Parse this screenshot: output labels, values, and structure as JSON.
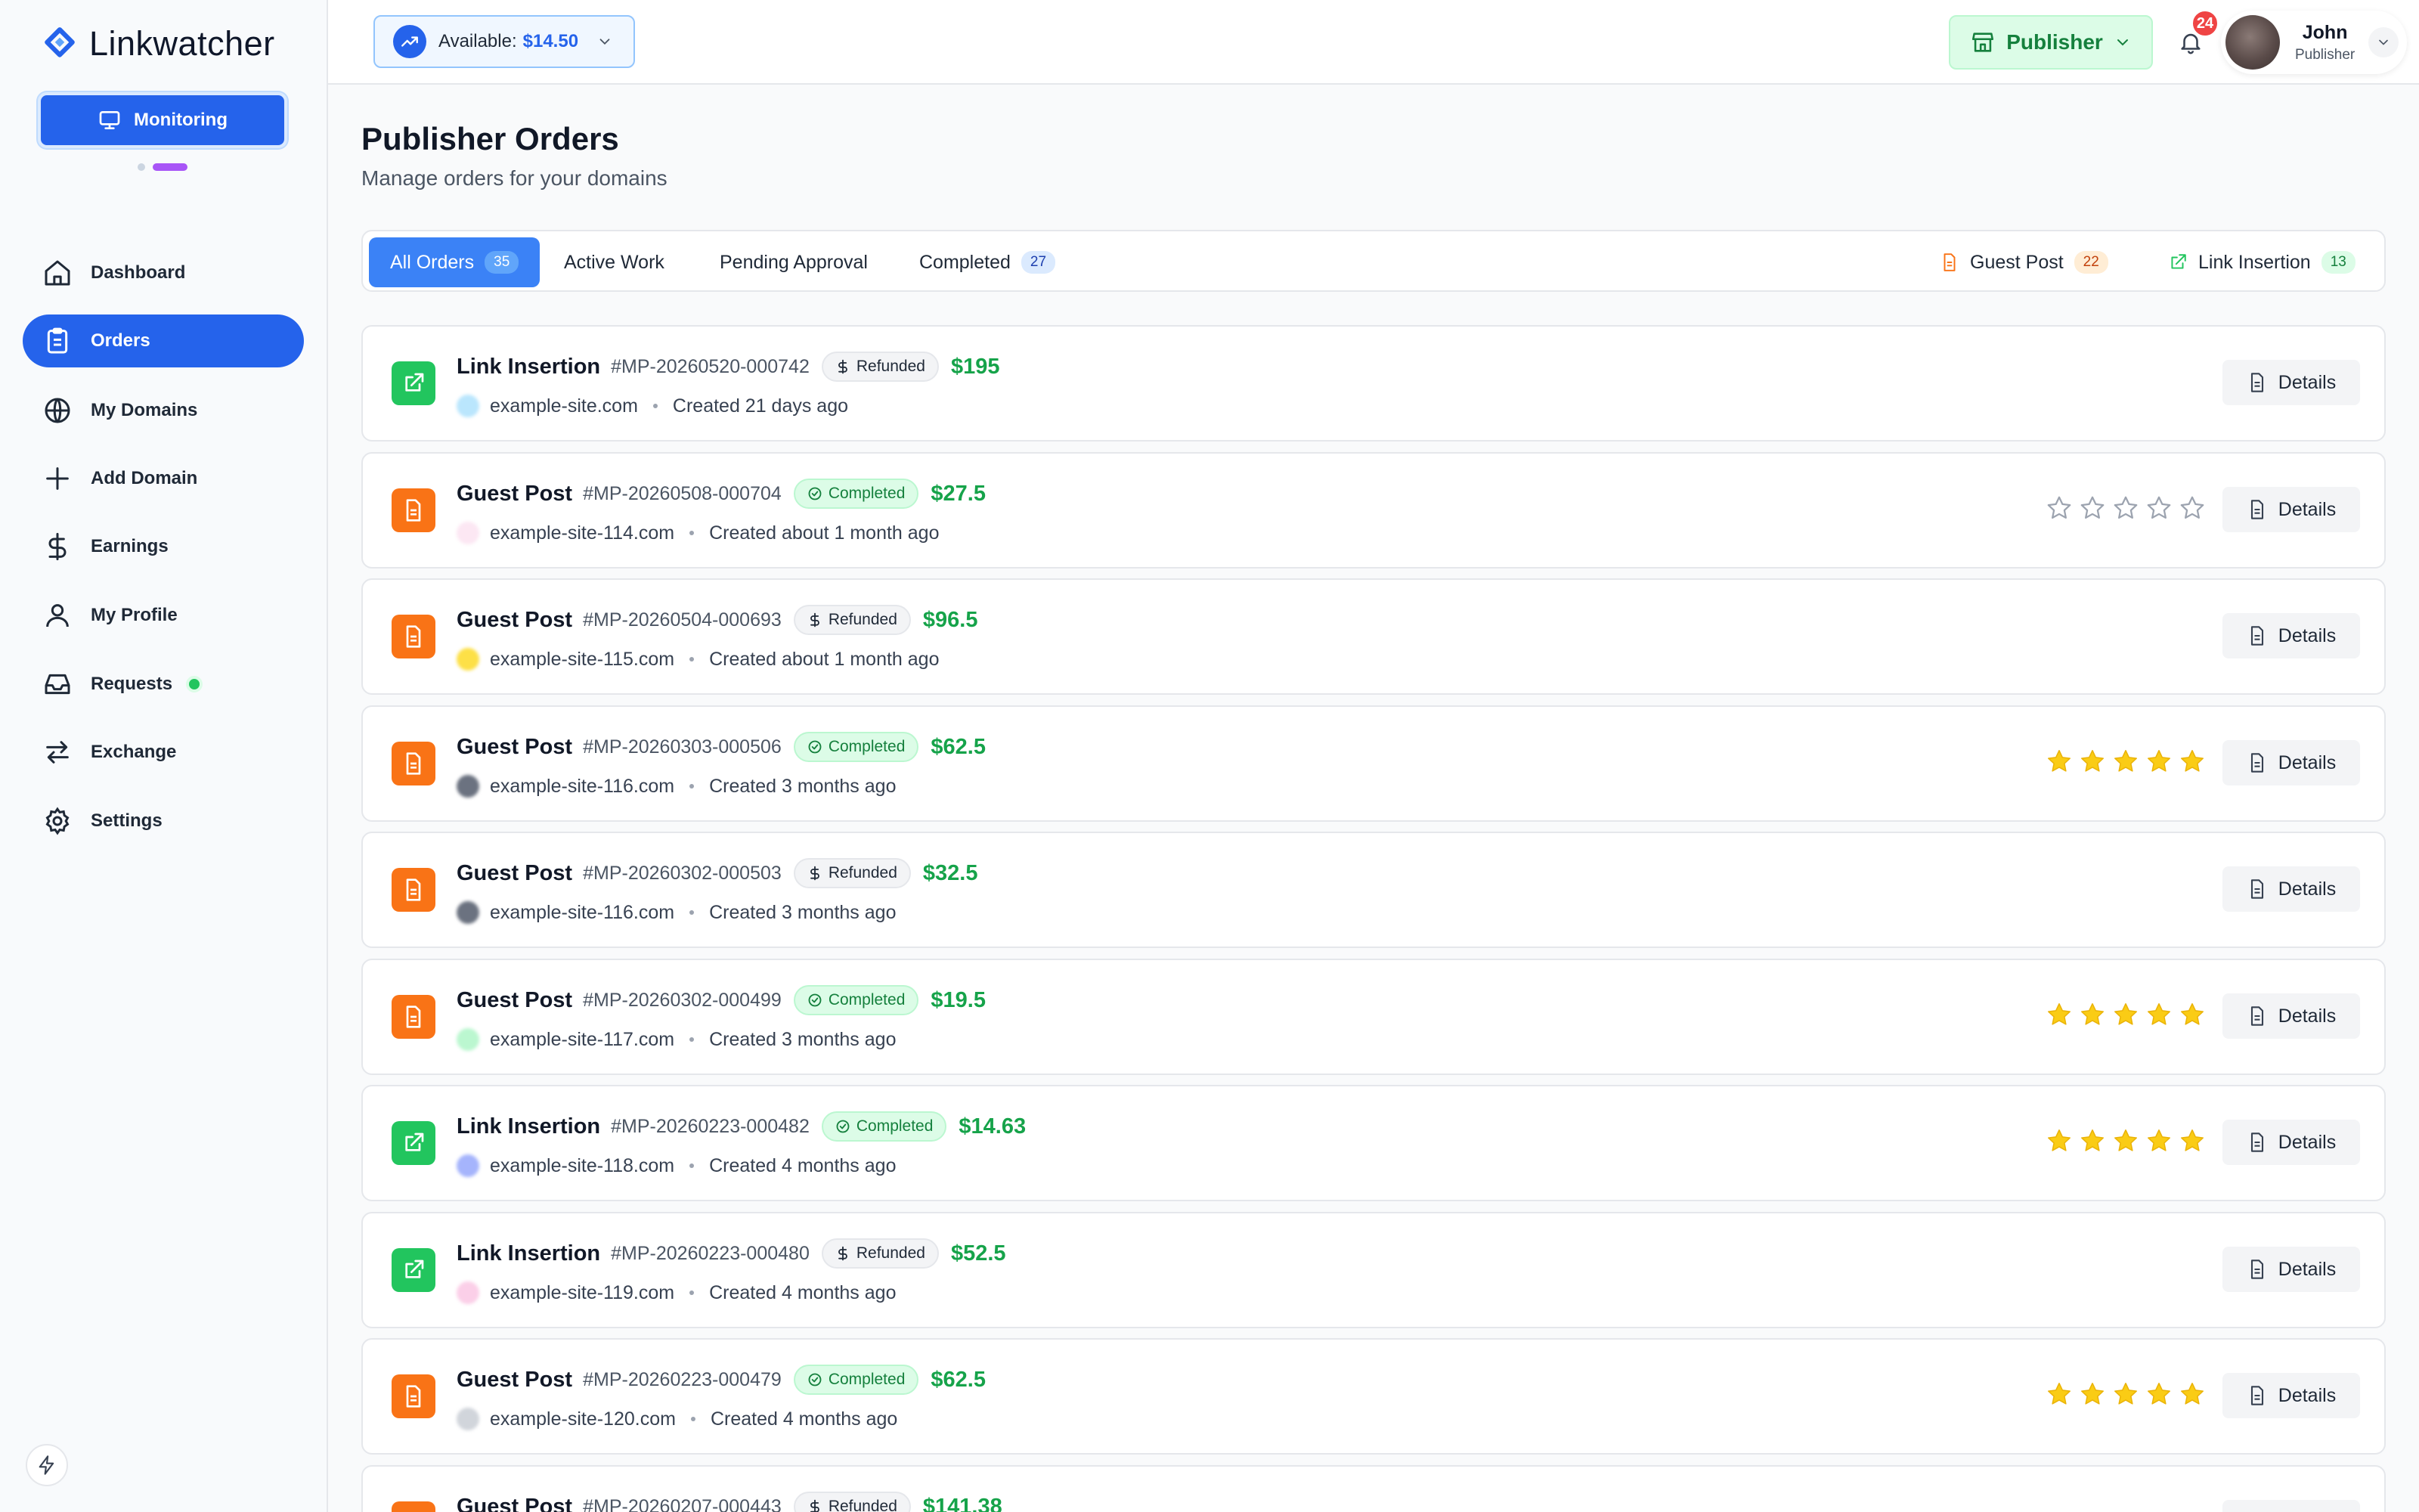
{
  "brand": {
    "name": "Linkwatcher"
  },
  "monitor_button": {
    "label": "Monitoring"
  },
  "sidebar": {
    "items": [
      {
        "label": "Dashboard",
        "icon": "home-icon"
      },
      {
        "label": "Orders",
        "icon": "clipboard-icon",
        "active": true
      },
      {
        "label": "My Domains",
        "icon": "globe-icon"
      },
      {
        "label": "Add Domain",
        "icon": "plus-icon"
      },
      {
        "label": "Earnings",
        "icon": "dollar-icon"
      },
      {
        "label": "My Profile",
        "icon": "user-icon"
      },
      {
        "label": "Requests",
        "icon": "inbox-icon",
        "status_dot": "#22c55e"
      },
      {
        "label": "Exchange",
        "icon": "exchange-icon"
      },
      {
        "label": "Settings",
        "icon": "gear-icon"
      }
    ]
  },
  "header": {
    "balance_label": "Available:",
    "balance_amount": "$14.50",
    "role_button": "Publisher",
    "notifications_count": "24",
    "user_name": "John",
    "user_role": "Publisher"
  },
  "page": {
    "title": "Publisher Orders",
    "subtitle": "Manage orders for your domains"
  },
  "tabs": [
    {
      "label": "All Orders",
      "count": "35",
      "active": true
    },
    {
      "label": "Active Work"
    },
    {
      "label": "Pending Approval"
    },
    {
      "label": "Completed",
      "count": "27"
    }
  ],
  "filters": [
    {
      "label": "Guest Post",
      "count": "22",
      "icon": "document-icon"
    },
    {
      "label": "Link Insertion",
      "count": "13",
      "icon": "external-link-icon"
    }
  ],
  "orders": [
    {
      "type": "Link Insertion",
      "id": "#MP-20260520-000742",
      "status": "Refunded",
      "price": "$195",
      "domain": "example-site.com",
      "created": "Created 21 days ago",
      "rating": null,
      "favicon_color": "#bae6fd"
    },
    {
      "type": "Guest Post",
      "id": "#MP-20260508-000704",
      "status": "Completed",
      "price": "$27.5",
      "domain": "example-site-114.com",
      "created": "Created about 1 month ago",
      "rating": 0,
      "favicon_color": "#fce7f3"
    },
    {
      "type": "Guest Post",
      "id": "#MP-20260504-000693",
      "status": "Refunded",
      "price": "$96.5",
      "domain": "example-site-115.com",
      "created": "Created about 1 month ago",
      "rating": null,
      "favicon_color": "#fde047"
    },
    {
      "type": "Guest Post",
      "id": "#MP-20260303-000506",
      "status": "Completed",
      "price": "$62.5",
      "domain": "example-site-116.com",
      "created": "Created 3 months ago",
      "rating": 5,
      "favicon_color": "#6b7280"
    },
    {
      "type": "Guest Post",
      "id": "#MP-20260302-000503",
      "status": "Refunded",
      "price": "$32.5",
      "domain": "example-site-116.com",
      "created": "Created 3 months ago",
      "rating": null,
      "favicon_color": "#6b7280"
    },
    {
      "type": "Guest Post",
      "id": "#MP-20260302-000499",
      "status": "Completed",
      "price": "$19.5",
      "domain": "example-site-117.com",
      "created": "Created 3 months ago",
      "rating": 5,
      "favicon_color": "#bbf7d0"
    },
    {
      "type": "Link Insertion",
      "id": "#MP-20260223-000482",
      "status": "Completed",
      "price": "$14.63",
      "domain": "example-site-118.com",
      "created": "Created 4 months ago",
      "rating": 5,
      "favicon_color": "#a5b4fc"
    },
    {
      "type": "Link Insertion",
      "id": "#MP-20260223-000480",
      "status": "Refunded",
      "price": "$52.5",
      "domain": "example-site-119.com",
      "created": "Created 4 months ago",
      "rating": null,
      "favicon_color": "#fbcfe8"
    },
    {
      "type": "Guest Post",
      "id": "#MP-20260223-000479",
      "status": "Completed",
      "price": "$62.5",
      "domain": "example-site-120.com",
      "created": "Created 4 months ago",
      "rating": 5,
      "favicon_color": "#d1d5db"
    },
    {
      "type": "Guest Post",
      "id": "#MP-20260207-000443",
      "status": "Refunded",
      "price": "$141.38",
      "domain": "",
      "created": "",
      "rating": null,
      "favicon_color": "#e5e7eb"
    }
  ],
  "details_label": "Details",
  "colors": {
    "accent": "#2563eb",
    "success": "#16a34a",
    "star": "#facc15",
    "guest_post": "#f97316",
    "link_insertion": "#22c55e"
  }
}
